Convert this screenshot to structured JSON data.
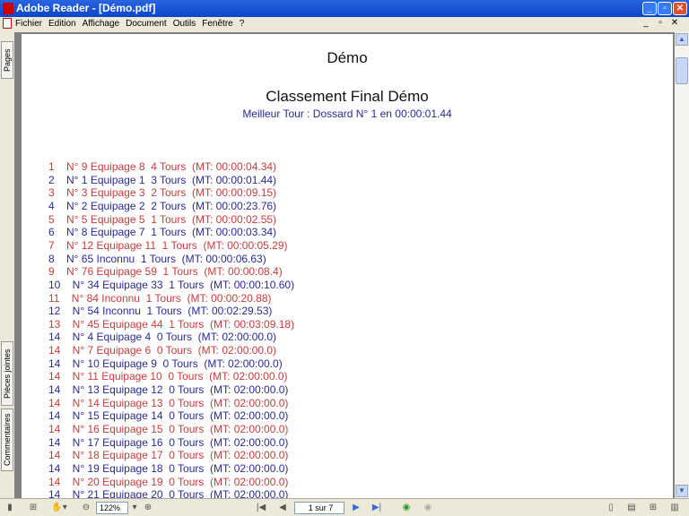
{
  "window": {
    "title": "Adobe Reader - [Démo.pdf]"
  },
  "menu": [
    "Fichier",
    "Edition",
    "Affichage",
    "Document",
    "Outils",
    "Fenêtre",
    "?"
  ],
  "side_tabs": {
    "pages": "Pages",
    "attachments": "Pièces jointes",
    "comments": "Commentaires"
  },
  "document": {
    "heading": "Démo",
    "title": "Classement Final Démo",
    "subtitle": "Meilleur Tour : Dossard N° 1 en 00:00:01.44",
    "rows": [
      "1    N° 9 Equipage 8  4 Tours  (MT: 00:00:04.34)",
      "2    N° 1 Equipage 1  3 Tours  (MT: 00:00:01.44)",
      "3    N° 3 Equipage 3  2 Tours  (MT: 00:00:09.15)",
      "4    N° 2 Equipage 2  2 Tours  (MT: 00:00:23.76)",
      "5    N° 5 Equipage 5  1 Tours  (MT: 00:00:02.55)",
      "6    N° 8 Equipage 7  1 Tours  (MT: 00:00:03.34)",
      "7    N° 12 Equipage 11  1 Tours  (MT: 00:00:05.29)",
      "8    N° 65 Inconnu  1 Tours  (MT: 00:00:06.63)",
      "9    N° 76 Equipage 59  1 Tours  (MT: 00:00:08.4)",
      "10    N° 34 Equipage 33  1 Tours  (MT: 00:00:10.60)",
      "11    N° 84 Inconnu  1 Tours  (MT: 00:00:20.88)",
      "12    N° 54 Inconnu  1 Tours  (MT: 00:02:29.53)",
      "13    N° 45 Equipage 44  1 Tours  (MT: 00:03:09.18)",
      "14    N° 4 Equipage 4  0 Tours  (MT: 02:00:00.0)",
      "14    N° 7 Equipage 6  0 Tours  (MT: 02:00:00.0)",
      "14    N° 10 Equipage 9  0 Tours  (MT: 02:00:00.0)",
      "14    N° 11 Equipage 10  0 Tours  (MT: 02:00:00.0)",
      "14    N° 13 Equipage 12  0 Tours  (MT: 02:00:00.0)",
      "14    N° 14 Equipage 13  0 Tours  (MT: 02:00:00.0)",
      "14    N° 15 Equipage 14  0 Tours  (MT: 02:00:00.0)",
      "14    N° 16 Equipage 15  0 Tours  (MT: 02:00:00.0)",
      "14    N° 17 Equipage 16  0 Tours  (MT: 02:00:00.0)",
      "14    N° 18 Equipage 17  0 Tours  (MT: 02:00:00.0)",
      "14    N° 19 Equipage 18  0 Tours  (MT: 02:00:00.0)",
      "14    N° 20 Equipage 19  0 Tours  (MT: 02:00:00.0)",
      "14    N° 21 Equipage 20  0 Tours  (MT: 02:00:00.0)"
    ],
    "row_colors": [
      "#c83c3c",
      "#2a2a9a",
      "#c83c3c",
      "#2a2a9a",
      "#c83c3c",
      "#2a2a9a",
      "#c83c3c",
      "#2a2a9a",
      "#c83c3c",
      "#2a2a9a",
      "#c83c3c",
      "#2a2a9a",
      "#c83c3c",
      "#2a2a9a",
      "#c83c3c",
      "#2a2a9a",
      "#c83c3c",
      "#2a2a9a",
      "#c83c3c",
      "#2a2a9a",
      "#c83c3c",
      "#2a2a9a",
      "#c83c3c",
      "#2a2a9a",
      "#c83c3c",
      "#2a2a9a"
    ]
  },
  "toolbar": {
    "zoom": "122%",
    "page": "1 sur 7"
  }
}
